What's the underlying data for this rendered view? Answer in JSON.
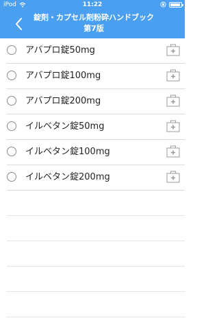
{
  "status_bar": {
    "carrier": "iPod",
    "time": "11:22",
    "icons": [
      "wifi-icon",
      "rotation-lock-icon",
      "battery-icon"
    ]
  },
  "nav": {
    "back_icon": "chevron-left-icon",
    "title": "錠剤・カプセル剤粉砕ハンドブック第7版"
  },
  "colors": {
    "header_bg": "#4a9ff0",
    "divider": "#dcdcdc"
  },
  "items": [
    {
      "name": "アバプロ錠50mg",
      "icon": "medical-kit-icon"
    },
    {
      "name": "アバプロ錠100mg",
      "icon": "medical-kit-icon"
    },
    {
      "name": "アバプロ錠200mg",
      "icon": "medical-kit-icon"
    },
    {
      "name": "イルベタン錠50mg",
      "icon": "medical-kit-icon"
    },
    {
      "name": "イルベタン錠100mg",
      "icon": "medical-kit-icon"
    },
    {
      "name": "イルベタン錠200mg",
      "icon": "medical-kit-icon"
    }
  ]
}
